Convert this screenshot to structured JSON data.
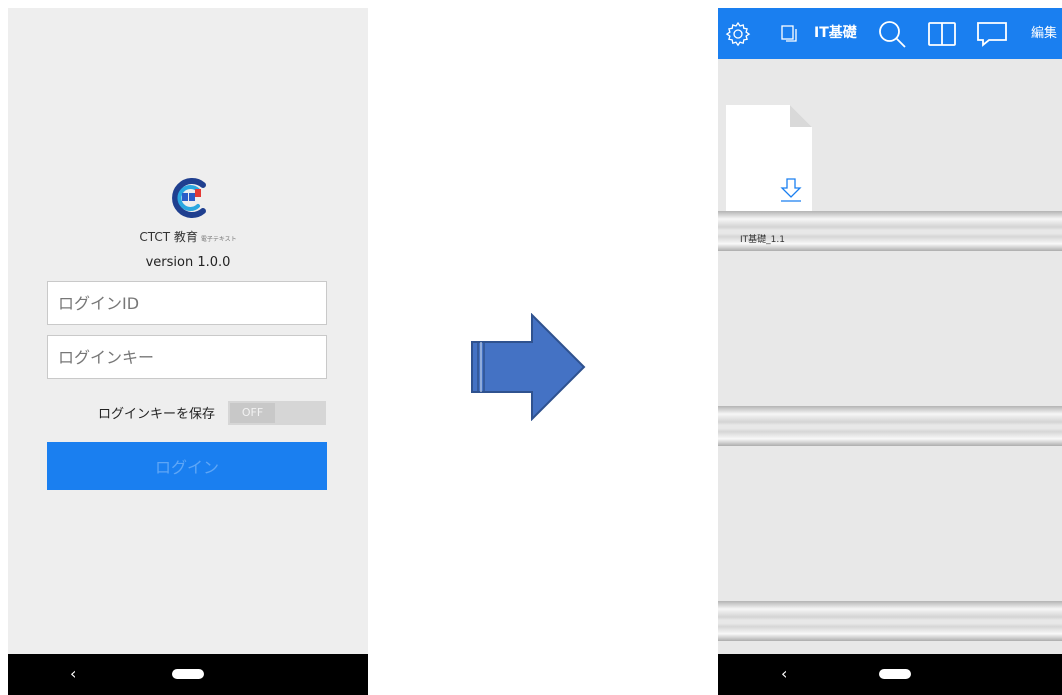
{
  "login": {
    "brand_name": "CTCT 教育",
    "brand_sub": "電子テキスト",
    "version": "version 1.0.0",
    "id_placeholder": "ログインID",
    "key_placeholder": "ログインキー",
    "save_label": "ログインキーを保存",
    "toggle_state": "OFF",
    "login_button": "ログイン"
  },
  "system_nav": {
    "back_glyph": "‹"
  },
  "bookshelf": {
    "title": "IT基礎",
    "edit_label": "編集",
    "toolbar_icons": [
      "settings-icon",
      "copy-icon",
      "search-icon",
      "book-icon",
      "comment-icon"
    ],
    "books": [
      {
        "title": "IT基礎_1.1",
        "status_icon": "download-icon"
      }
    ]
  },
  "colors": {
    "accent": "#1a7ff0",
    "arrow_fill": "#4472c4",
    "arrow_stroke": "#2f528f"
  }
}
